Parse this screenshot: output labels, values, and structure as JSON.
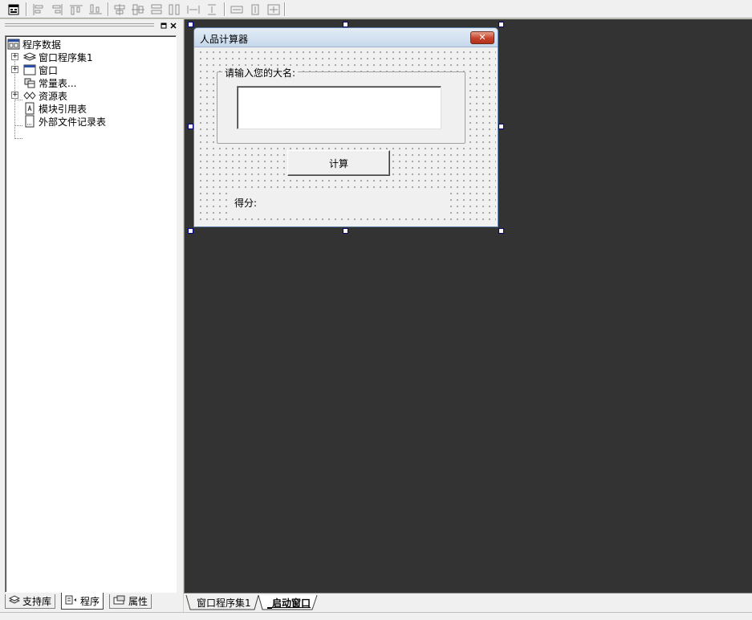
{
  "tree": {
    "root": "程序数据",
    "items": [
      {
        "label": "窗口程序集1",
        "icon": "layers-icon",
        "expandable": true
      },
      {
        "label": "窗口",
        "icon": "window-icon",
        "expandable": true
      },
      {
        "label": "常量表...",
        "icon": "constant-table-icon",
        "expandable": false
      },
      {
        "label": "资源表",
        "icon": "resource-icon",
        "expandable": true
      },
      {
        "label": "模块引用表",
        "icon": "module-ref-icon",
        "expandable": false
      },
      {
        "label": "外部文件记录表",
        "icon": "file-record-icon",
        "expandable": false
      }
    ]
  },
  "left_tabs": [
    {
      "label": "支持库",
      "icon": "library-icon"
    },
    {
      "label": "程序",
      "icon": "program-icon"
    },
    {
      "label": "属性",
      "icon": "property-icon"
    }
  ],
  "form": {
    "title": "人品计算器",
    "close_symbol": "✕",
    "groupbox_label": "请输入您的大名:",
    "input_value": "",
    "button_label": "计算",
    "score_label": "得分:"
  },
  "workspace_tabs": [
    {
      "label": "窗口程序集1",
      "active": false
    },
    {
      "label": "_启动窗口",
      "active": true
    }
  ],
  "colors": {
    "workspace_bg": "#333333",
    "title_bar": "#c7d8ec",
    "close_button": "#c6422b",
    "selection_handle": "#000080"
  }
}
